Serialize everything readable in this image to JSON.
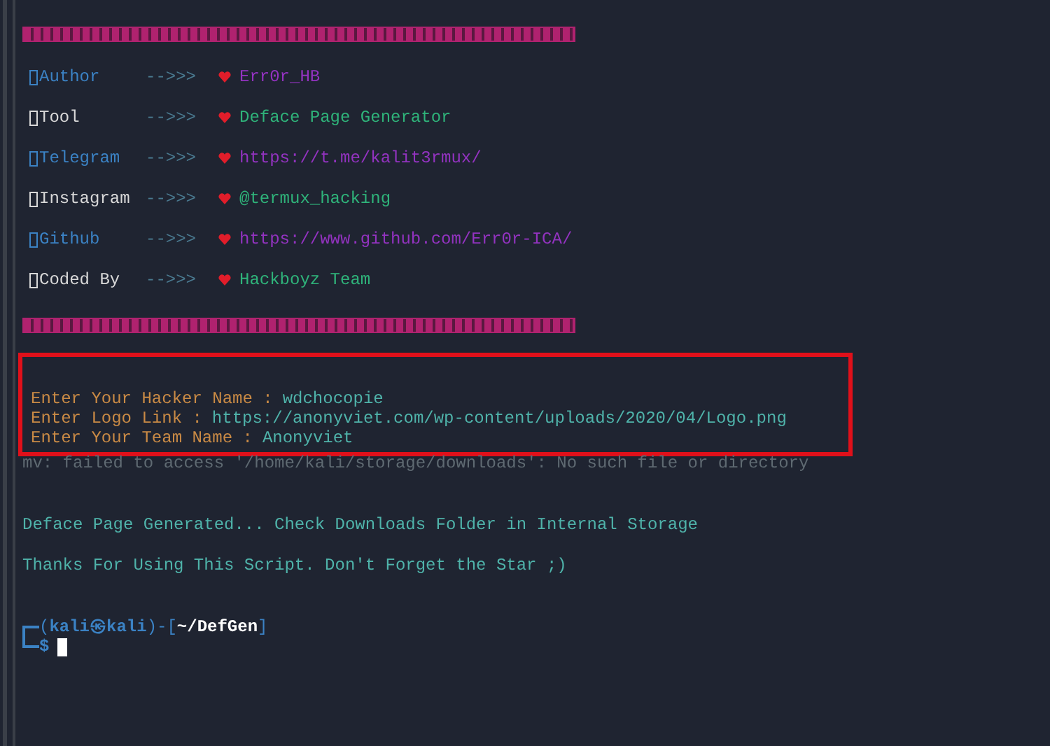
{
  "banner_rows": [
    {
      "label": "Author",
      "arrow": "-->>>",
      "value": "Err0r_HB",
      "kind": "primary"
    },
    {
      "label": "Tool",
      "arrow": "-->>>",
      "value": "Deface Page Generator",
      "kind": "secondary"
    },
    {
      "label": "Telegram",
      "arrow": "-->>>",
      "value": "https://t.me/kalit3rmux/",
      "kind": "primary"
    },
    {
      "label": "Instagram",
      "arrow": "-->>>",
      "value": "@termux_hacking",
      "kind": "secondary"
    },
    {
      "label": "Github",
      "arrow": "-->>>",
      "value": "https://www.github.com/Err0r-ICA/",
      "kind": "primary"
    },
    {
      "label": "Coded By",
      "arrow": "-->>>",
      "value": "Hackboyz Team",
      "kind": "secondary"
    }
  ],
  "prompts": [
    {
      "question": "Enter Your Hacker Name :",
      "answer": "wdchocopie"
    },
    {
      "question": "Enter Logo Link :",
      "answer": "https://anonyviet.com/wp-content/uploads/2020/04/Logo.png"
    },
    {
      "question": "Enter Your Team Name :",
      "answer": "Anonyviet"
    }
  ],
  "error_line": "mv: failed to access '/home/kali/storage/downloads': No such file or directory",
  "messages": [
    "Deface Page Generated... Check Downloads Folder in Internal Storage",
    "Thanks For Using This Script. Don't Forget the Star ;)"
  ],
  "shell_prompt": {
    "segments": [
      {
        "text": "(",
        "kind": "punct"
      },
      {
        "text": "kali㉿kali",
        "kind": "user"
      },
      {
        "text": ")-[",
        "kind": "punct"
      },
      {
        "text": "~/DefGen",
        "kind": "path"
      },
      {
        "text": "]",
        "kind": "punct"
      }
    ],
    "symbol": "$"
  }
}
